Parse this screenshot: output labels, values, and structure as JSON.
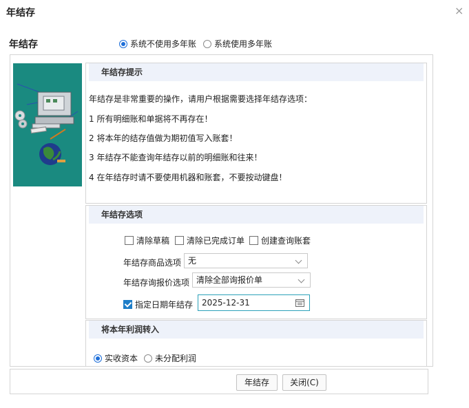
{
  "window": {
    "title": "年结存",
    "close_glyph": "×"
  },
  "section_label": "年结存",
  "mode": {
    "options": [
      {
        "label": "系统不使用多年账",
        "selected": true
      },
      {
        "label": "系统使用多年账",
        "selected": false
      }
    ]
  },
  "tips": {
    "header": "年结存提示",
    "lines": [
      "年结存是非常重要的操作，请用户根据需要选择年结存选项：",
      "1 所有明细账和单据将不再存在！",
      "2 将本年的结存值做为期初值写入账套！",
      "3 年结存不能查询年结存以前的明细账和往来！",
      "4 在年结存时请不要使用机器和账套，不要按动键盘！"
    ]
  },
  "options": {
    "header": "年结存选项",
    "checks": [
      {
        "label": "清除草稿",
        "checked": false
      },
      {
        "label": "清除已完成订单",
        "checked": false
      },
      {
        "label": "创建查询账套",
        "checked": false
      }
    ],
    "goods_label": "年结存商品选项",
    "goods_value": "无",
    "inquiry_label": "年结存询报价选项",
    "inquiry_value": "清除全部询报价单",
    "date_check_label": "指定日期年结存",
    "date_checked": true,
    "date_value": "2025-12-31"
  },
  "profit": {
    "header": "将本年利润转入",
    "options": [
      {
        "label": "实收资本",
        "selected": true
      },
      {
        "label": "未分配利润",
        "selected": false
      }
    ]
  },
  "buttons": {
    "confirm": "年结存",
    "close": "关闭(C)"
  }
}
